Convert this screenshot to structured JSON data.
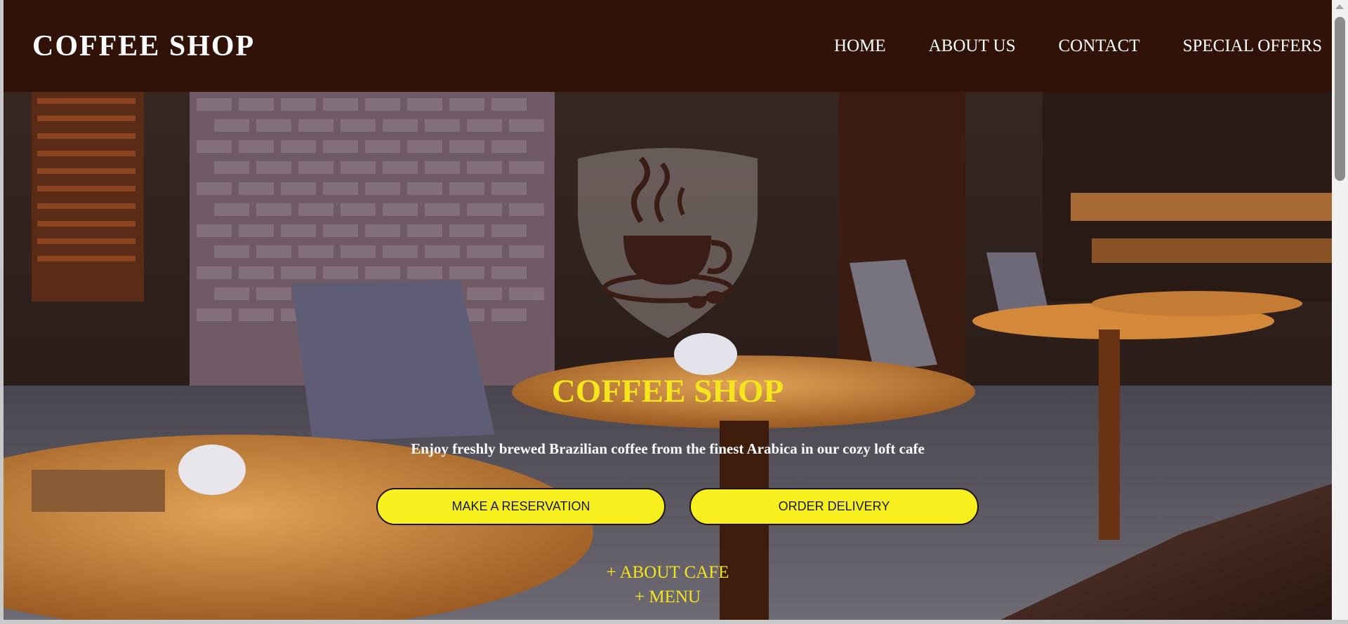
{
  "header": {
    "brand": "COFFEE SHOP",
    "nav": [
      {
        "label": "HOME"
      },
      {
        "label": "ABOUT US"
      },
      {
        "label": "CONTACT"
      },
      {
        "label": "SPECIAL OFFERS"
      }
    ]
  },
  "hero": {
    "logo_icon": "coffee-cup-shield-icon",
    "title": "COFFEE SHOP",
    "subtitle": "Enjoy freshly brewed Brazilian coffee from the finest Arabica in our cozy loft cafe",
    "reservation_button": "MAKE A RESERVATION",
    "delivery_button": "ORDER DELIVERY",
    "about_toggle": "+ ABOUT CAFE",
    "menu_toggle": "+ MENU"
  },
  "colors": {
    "header_bg": "#301209",
    "accent_yellow": "#f4e51c",
    "button_yellow": "#f7f01e"
  }
}
